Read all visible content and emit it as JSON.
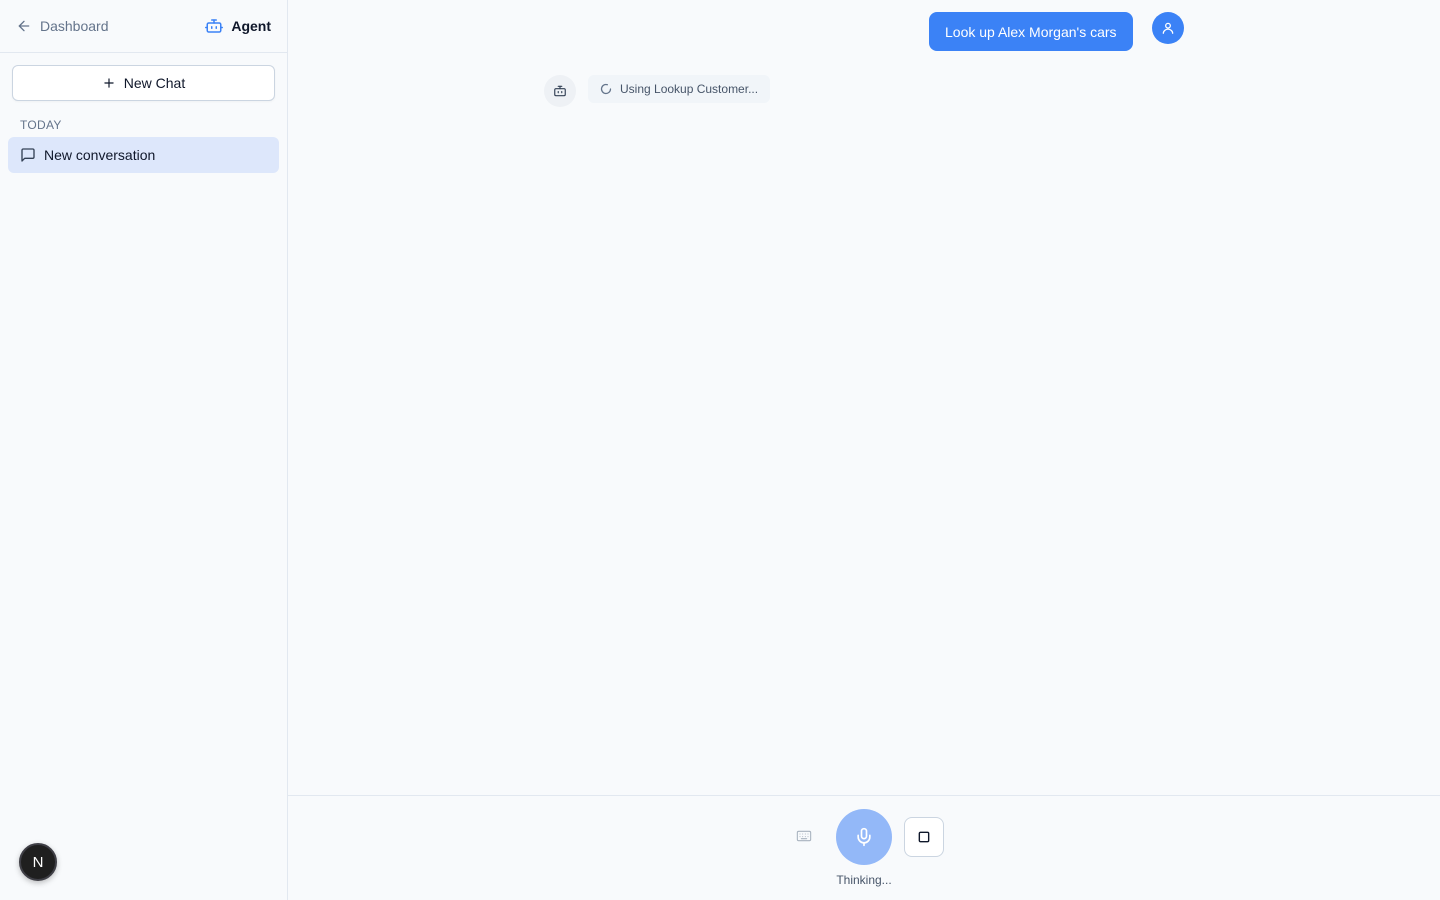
{
  "sidebar": {
    "back_label": "Dashboard",
    "agent_label": "Agent",
    "new_chat_label": "New Chat",
    "section_label": "TODAY",
    "conversations": [
      {
        "label": "New conversation",
        "active": true
      }
    ],
    "user_initial": "N"
  },
  "chat": {
    "user_message": "Look up Alex Morgan's cars",
    "tool_status": "Using Lookup Customer..."
  },
  "controls": {
    "status": "Thinking..."
  },
  "colors": {
    "accent": "#3b82f6",
    "mic_active": "#93b8f8",
    "active_item_bg": "#dde7fb"
  }
}
